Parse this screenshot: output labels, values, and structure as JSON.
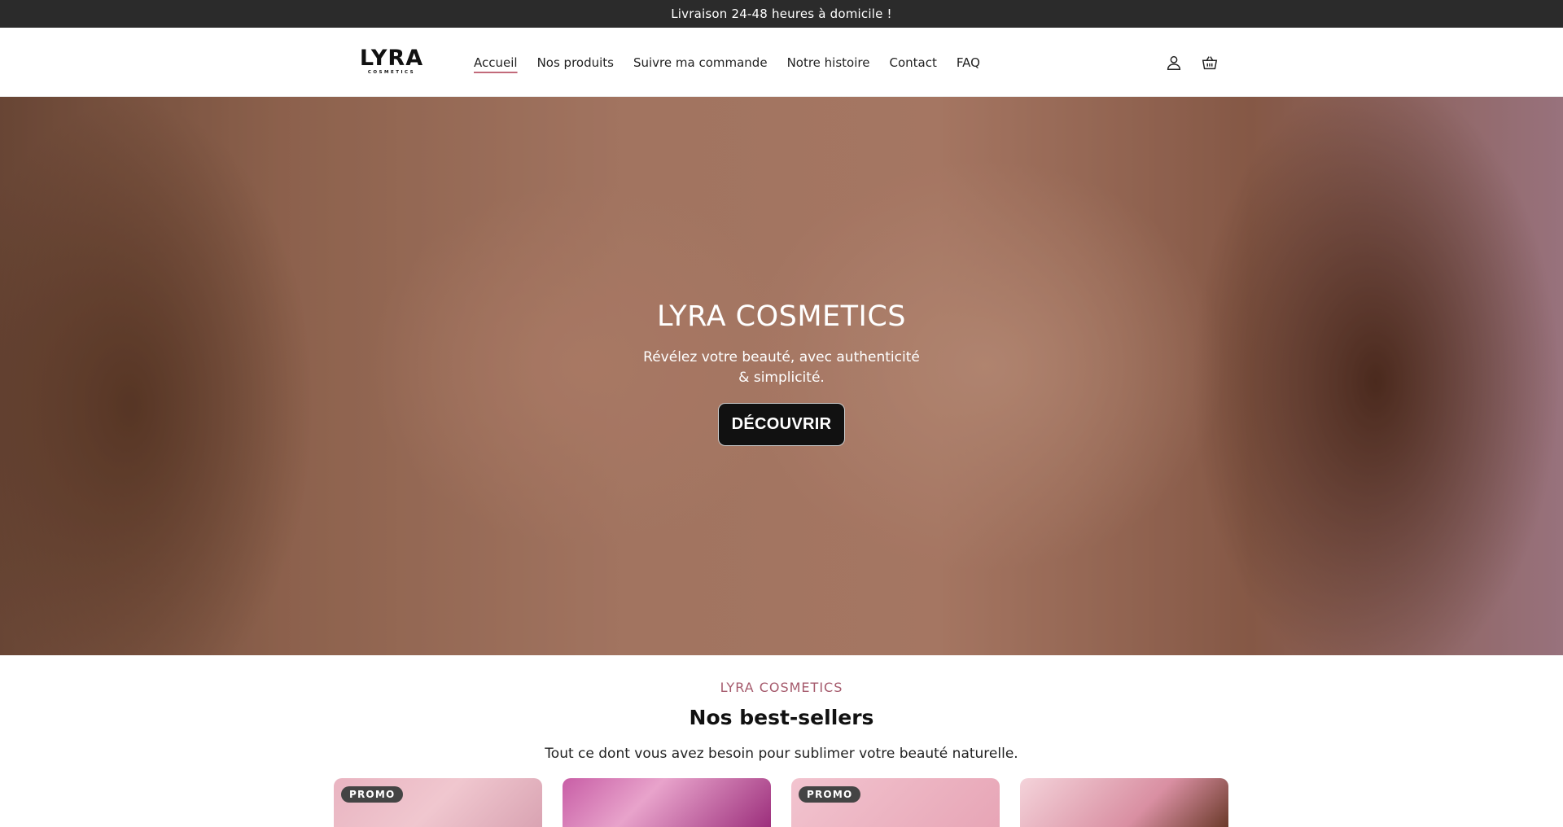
{
  "announcement": "Livraison 24-48 heures à domicile !",
  "logo": {
    "main": "LYRA",
    "sub": "COSMETICS"
  },
  "nav": [
    {
      "label": "Accueil"
    },
    {
      "label": "Nos produits"
    },
    {
      "label": "Suivre ma commande"
    },
    {
      "label": "Notre histoire"
    },
    {
      "label": "Contact"
    },
    {
      "label": "FAQ"
    }
  ],
  "icons": {
    "account": "account-icon",
    "cart": "cart-icon"
  },
  "hero": {
    "title": "LYRA COSMETICS",
    "subtitle": "Révélez votre beauté, avec authenticité & simplicité.",
    "button": "DÉCOUVRIR"
  },
  "bestsellers": {
    "eyebrow": "LYRA COSMETICS",
    "title": "Nos best-sellers",
    "description": "Tout ce dont vous avez besoin pour sublimer votre beauté naturelle."
  },
  "products": [
    {
      "badge": "PROMO"
    },
    {
      "badge": ""
    },
    {
      "badge": "PROMO"
    },
    {
      "badge": ""
    }
  ],
  "colors": {
    "accent": "#a55a6c",
    "topbar": "#2b2b2b",
    "button": "#111111"
  }
}
